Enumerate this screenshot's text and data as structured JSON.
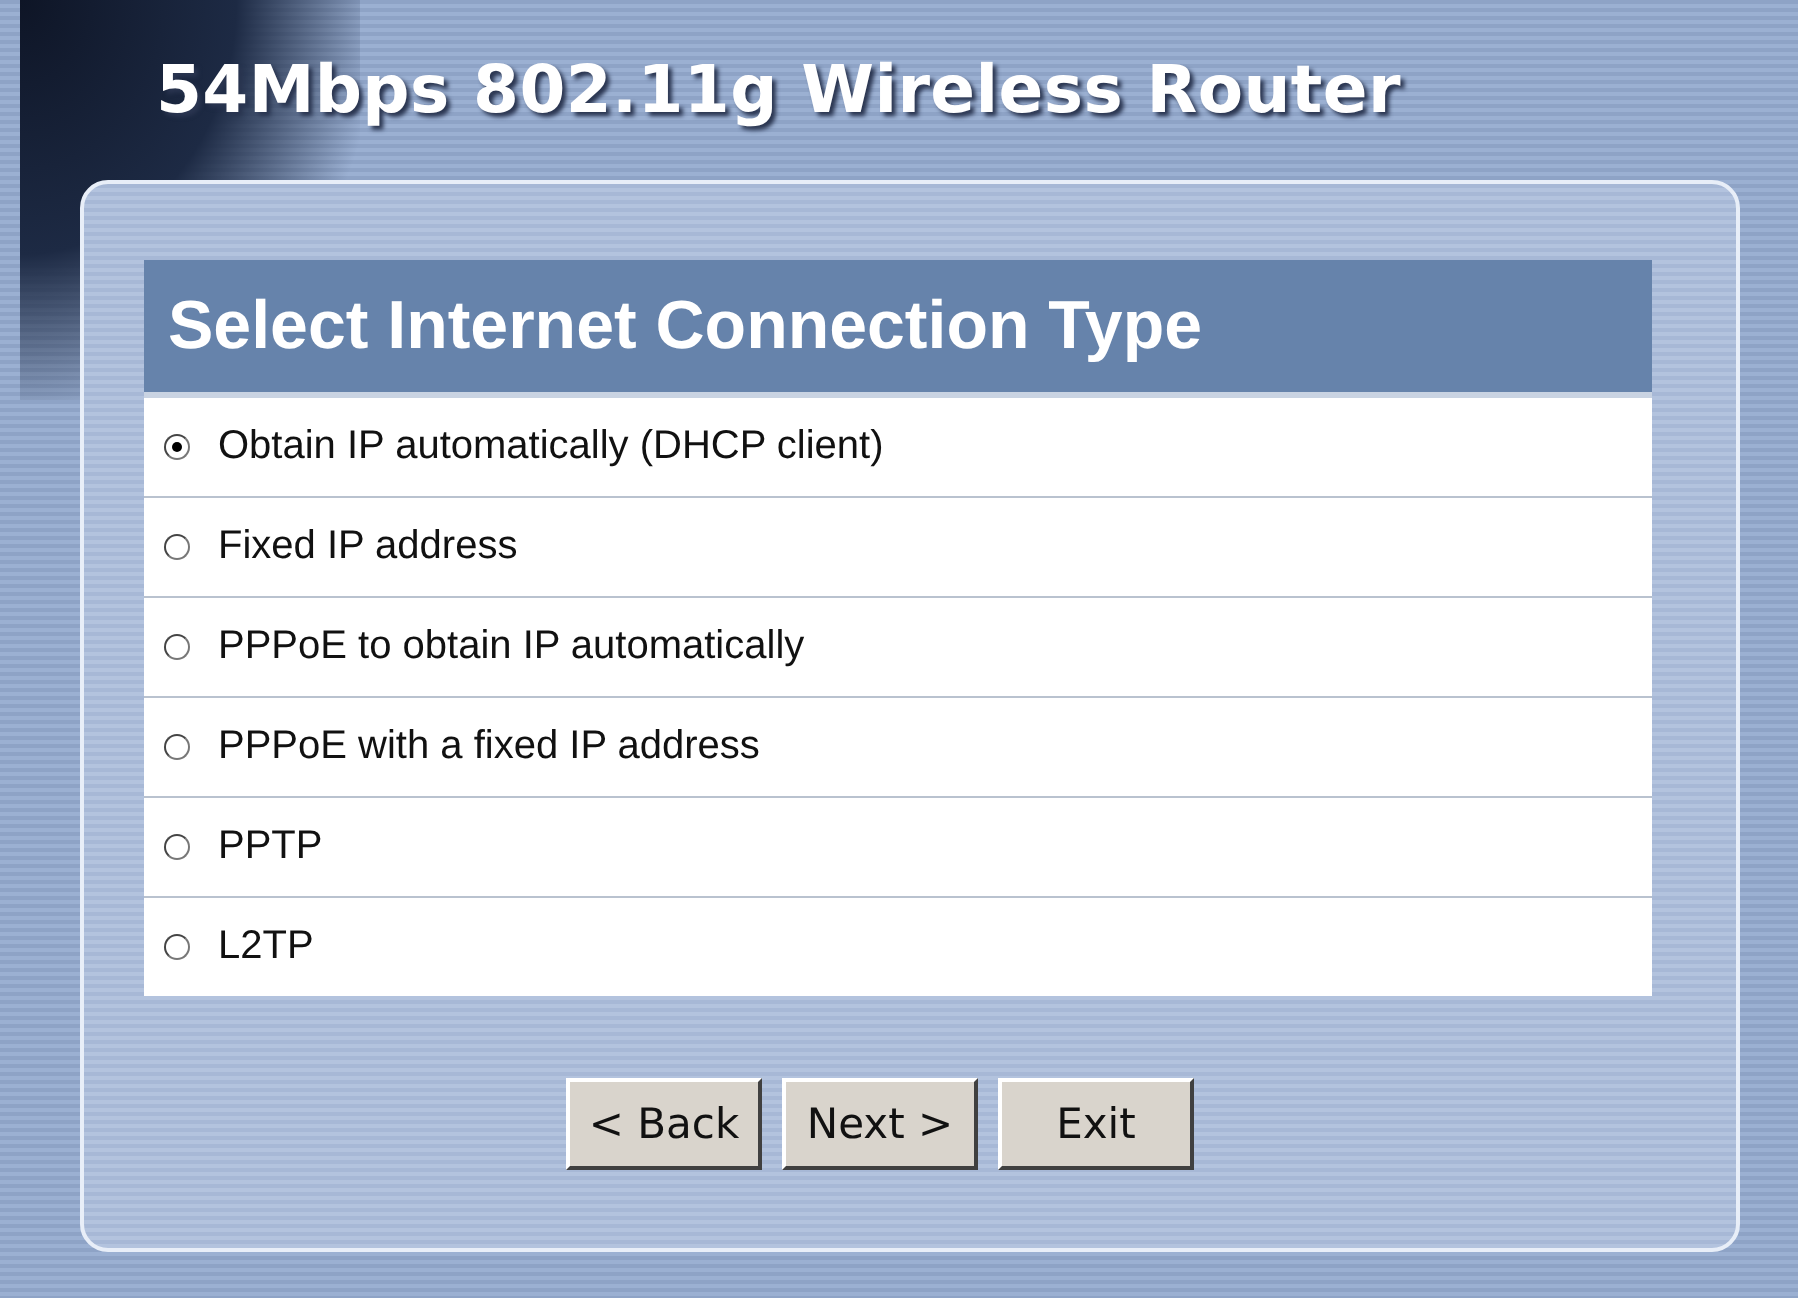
{
  "header": {
    "title": "54Mbps 802.11g Wireless Router"
  },
  "panel": {
    "title": "Select Internet Connection Type",
    "options": [
      {
        "label": "Obtain IP automatically (DHCP client)",
        "selected": true
      },
      {
        "label": "Fixed IP address",
        "selected": false
      },
      {
        "label": "PPPoE to obtain IP automatically",
        "selected": false
      },
      {
        "label": "PPPoE with a fixed IP address",
        "selected": false
      },
      {
        "label": "PPTP",
        "selected": false
      },
      {
        "label": "L2TP",
        "selected": false
      }
    ]
  },
  "buttons": [
    "< Back",
    "Next >",
    "Exit"
  ]
}
